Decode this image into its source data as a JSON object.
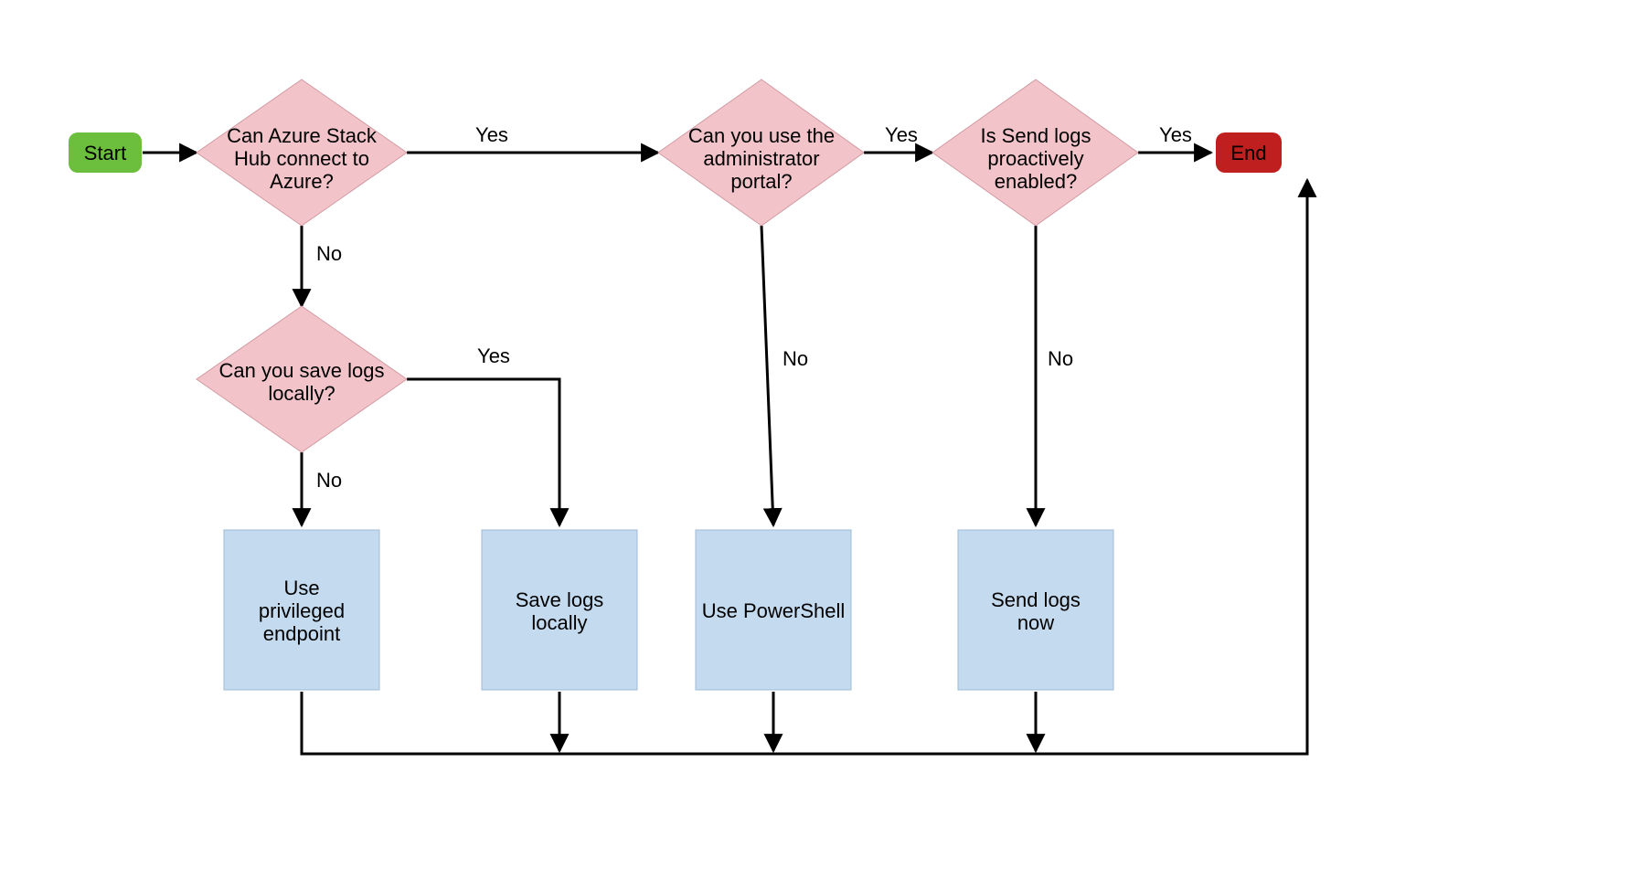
{
  "nodes": {
    "start": "Start",
    "end": "End",
    "d1_l1": "Can Azure Stack",
    "d1_l2": "Hub connect to",
    "d1_l3": "Azure?",
    "d2_l1": "Can you use the",
    "d2_l2": "administrator",
    "d2_l3": "portal?",
    "d3_l1": "Is Send logs",
    "d3_l2": "proactively",
    "d3_l3": "enabled?",
    "d4_l1": "Can you save logs",
    "d4_l2": "locally?",
    "p1_l1": "Use",
    "p1_l2": "privileged",
    "p1_l3": "endpoint",
    "p2_l1": "Save logs",
    "p2_l2": "locally",
    "p3_l1": "Use PowerShell",
    "p4_l1": "Send logs",
    "p4_l2": "now"
  },
  "labels": {
    "yes": "Yes",
    "no": "No"
  },
  "colors": {
    "start": "#6cbe3d",
    "end": "#c01f1f",
    "decision": "#f2c4ca",
    "decisionStroke": "#d19aa2",
    "process": "#c4dbef",
    "processStroke": "#9fbbd4",
    "edge": "#000000"
  }
}
